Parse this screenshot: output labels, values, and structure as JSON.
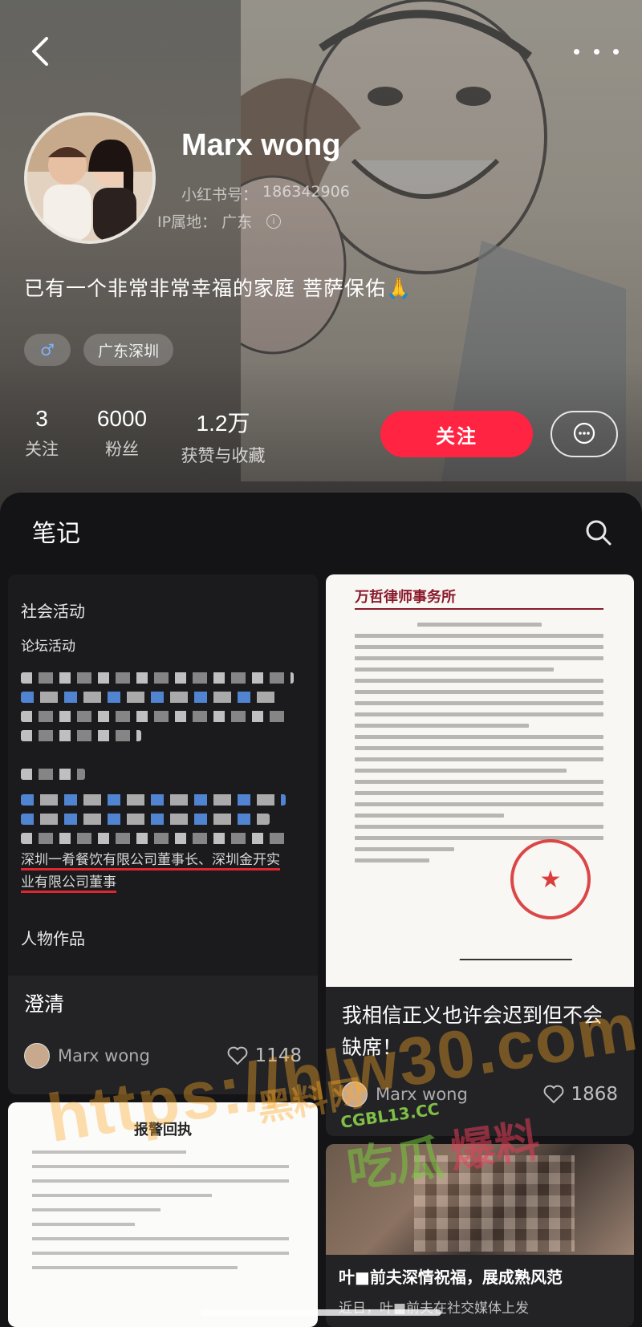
{
  "profile": {
    "username": "Marx wong",
    "rednote_id_label": "小红书号：",
    "rednote_id": "186342906",
    "ip_label": "IP属地：",
    "ip_location": "广东",
    "bio": "已有一个非常非常幸福的家庭 菩萨保佑🙏",
    "gender_symbol": "♂",
    "location_tag": "广东深圳"
  },
  "stats": [
    {
      "value": "3",
      "label": "关注"
    },
    {
      "value": "6000",
      "label": "粉丝"
    },
    {
      "value": "1.2万",
      "label": "获赞与收藏"
    }
  ],
  "actions": {
    "follow_label": "关注"
  },
  "notes_section": {
    "title": "笔记"
  },
  "cards": [
    {
      "doc_heading_1": "社会活动",
      "doc_heading_2": "论坛活动",
      "doc_underlined_1": "深圳一肴餐饮有限公司董事长、深圳金开实",
      "doc_underlined_2": "业有限公司董事",
      "doc_heading_3": "人物作品",
      "title": "澄清",
      "author": "Marx wong",
      "likes": "1148"
    },
    {
      "doc_logo": "万哲律师事务所",
      "title": "我相信正义也许会迟到但不会缺席！",
      "author": "Marx wong",
      "likes": "1868"
    },
    {
      "doc_title": "报警回执"
    },
    {
      "snippet_title": "叶■前夫深情祝福，展成熟风范",
      "snippet_body": "近日，叶■前夫在社交媒体上发"
    }
  ],
  "watermarks": {
    "url": "https://hlw30.com",
    "site": "CGBL13.CC",
    "brand_a": "吃瓜",
    "brand_b": "爆料",
    "overlay_text": "黑料网"
  },
  "colors": {
    "accent": "#ff2442",
    "panel_bg": "#141416"
  }
}
